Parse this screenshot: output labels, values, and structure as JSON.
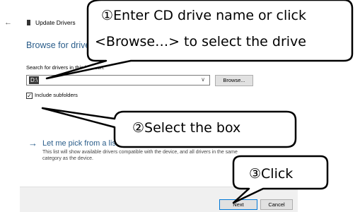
{
  "window": {
    "title": "Update Drivers"
  },
  "heading": "Browse for drivers on your computer",
  "search": {
    "label": "Search for drivers in this location:",
    "value": "D:\\",
    "browse_label": "Browse..."
  },
  "subfolders": {
    "label": "Include subfolders",
    "checked": true
  },
  "pick": {
    "title": "Let me pick from a list of available drivers on my computer",
    "description": "This list will show available drivers compatible with the device, and all drivers in the same category as the device."
  },
  "footer": {
    "next_label": "Next",
    "cancel_label": "Cancel"
  },
  "annotations": {
    "step1_line1": "①Enter CD drive name or click",
    "step1_line2": "<Browse…> to select the drive",
    "step2": "②Select the box",
    "step3": "③Click"
  },
  "icons": {
    "back": "back-arrow-icon",
    "device": "device-icon",
    "pick": "right-arrow-icon",
    "combo": "chevron-down-icon",
    "check": "checkmark-icon"
  }
}
